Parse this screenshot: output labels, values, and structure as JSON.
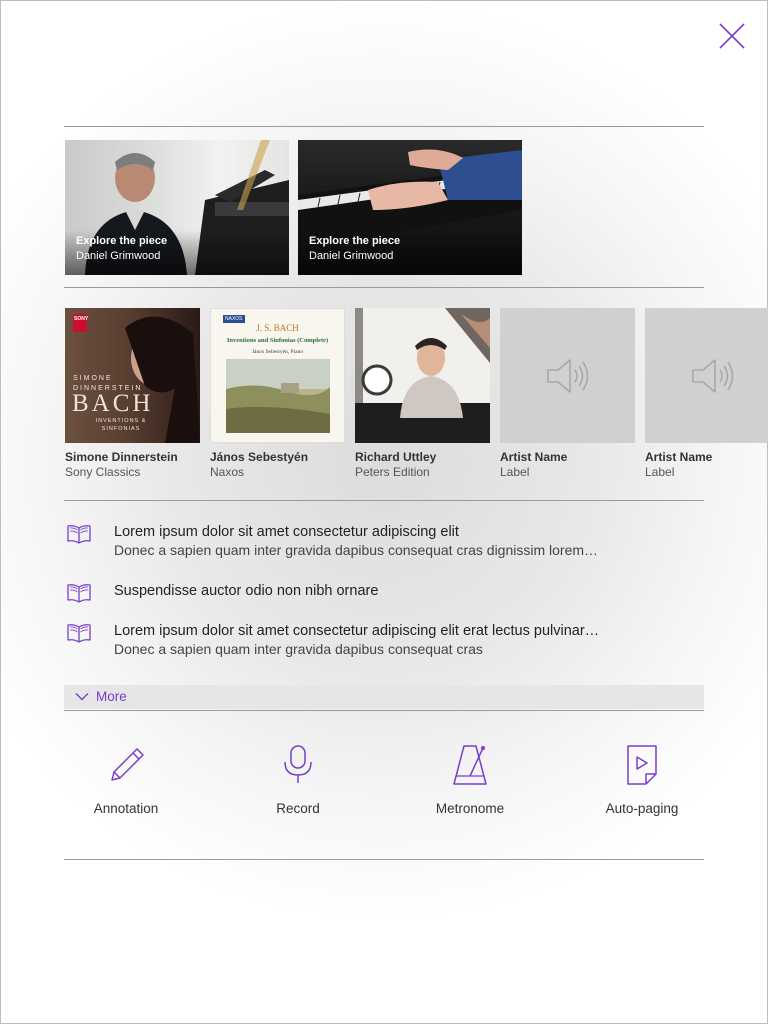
{
  "accent_color": "#7a3ec9",
  "close_icon": "close-icon",
  "videos": [
    {
      "title": "Explore the piece",
      "subtitle": "Daniel Grimwood"
    },
    {
      "title": "Explore the piece",
      "subtitle": "Daniel Grimwood"
    }
  ],
  "recordings": [
    {
      "artist": "Simone Dinnerstein",
      "label": "Sony Classics",
      "cover_text": "SIMONE DINNERSTEIN",
      "cover_title": "BACH",
      "cover_sub": "INVENTIONS & SINFONIAS",
      "cover_badge": "SONY"
    },
    {
      "artist": "János Sebestyén",
      "label": "Naxos",
      "cover_text": "J. S. BACH",
      "cover_title": "Inventions and Sinfonias (Complete)",
      "cover_sub": "János Sebestyén, Piano",
      "cover_badge": "NAXOS"
    },
    {
      "artist": "Richard Uttley",
      "label": "Peters Edition"
    },
    {
      "artist": "Artist Name",
      "label": "Label",
      "icon": "speaker-icon"
    },
    {
      "artist": "Artist Name",
      "label": "Label",
      "icon": "speaker-icon"
    }
  ],
  "lessons": [
    {
      "title": "Lorem ipsum dolor sit amet consectetur adipiscing elit",
      "subtitle": "Donec a sapien quam inter gravida dapibus consequat cras dignissim lorem…"
    },
    {
      "title": "Suspendisse auctor odio non nibh ornare",
      "subtitle": ""
    },
    {
      "title": "Lorem ipsum dolor sit amet consectetur adipiscing elit erat lectus pulvinar…",
      "subtitle": "Donec a sapien quam inter gravida dapibus consequat cras"
    }
  ],
  "more_label": "More",
  "tools": [
    {
      "label": "Annotation",
      "icon": "pencil-icon"
    },
    {
      "label": "Record",
      "icon": "microphone-icon"
    },
    {
      "label": "Metronome",
      "icon": "metronome-icon"
    },
    {
      "label": "Auto-paging",
      "icon": "auto-paging-icon"
    }
  ]
}
